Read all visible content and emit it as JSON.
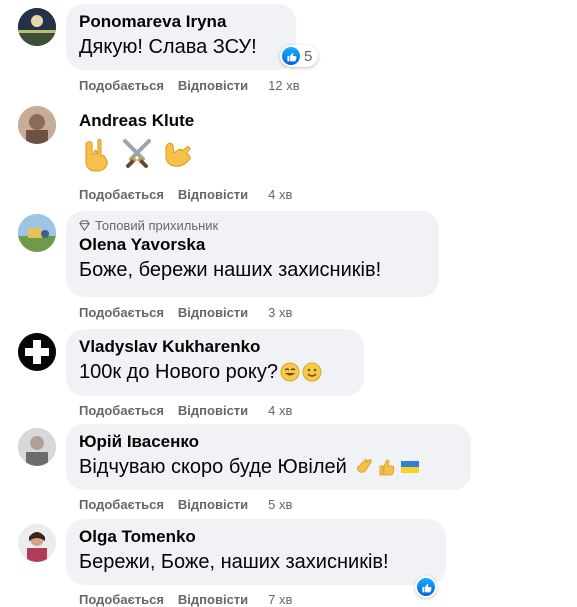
{
  "actions": {
    "like": "Подобається",
    "reply": "Відповісти"
  },
  "comments": [
    {
      "author": "Ponomareva Iryna",
      "text": "Дякую! Слава ЗСУ!",
      "time": "12 хв",
      "reactions_count": "5"
    },
    {
      "author": "Andreas Klute",
      "text": "",
      "time": "4 хв",
      "emoji": [
        "metal-hand-emoji",
        "crossed-swords-emoji",
        "call-me-hand-emoji"
      ]
    },
    {
      "author": "Olena Yavorska",
      "badge": "Топовий прихильник",
      "text": "Боже, бережи наших захисників!",
      "time": "3 хв"
    },
    {
      "author": "Vladyslav Kukharenko",
      "text": "100к до Нового року?",
      "time": "4 хв",
      "emoji": [
        "grin-emoji",
        "smile-emoji"
      ]
    },
    {
      "author": "Юрій Івасенко",
      "text": "Відчуваю скоро буде Ювілей",
      "time": "5 хв",
      "emoji": [
        "clapping-hands-emoji",
        "thumbs-up-emoji",
        "ukraine-flag-emoji"
      ]
    },
    {
      "author": "Olga Tomenko",
      "text": "Бережи, Боже, наших захисників!",
      "time": "7 хв"
    }
  ],
  "colors": {
    "bubble": "#f0f2f5",
    "meta": "#65676b",
    "like_blue": "#0866ff"
  }
}
